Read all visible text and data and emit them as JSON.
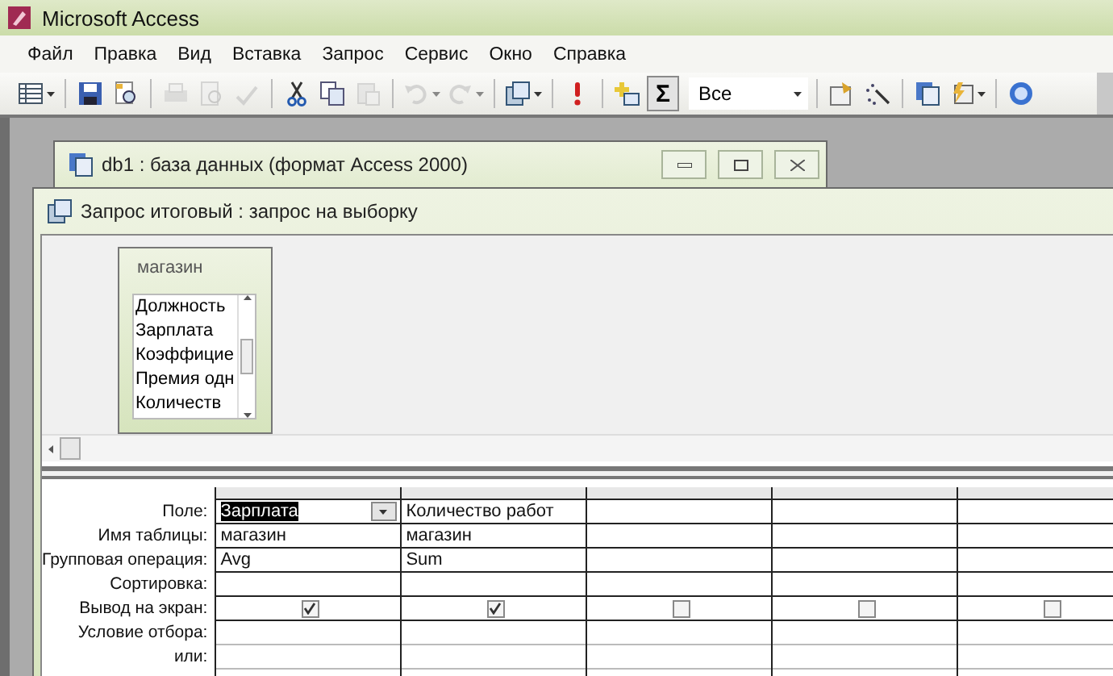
{
  "app_title": "Microsoft Access",
  "menu": [
    "Файл",
    "Правка",
    "Вид",
    "Вставка",
    "Запрос",
    "Сервис",
    "Окно",
    "Справка"
  ],
  "toolbar": [
    {
      "kind": "view",
      "disabled": false
    },
    {
      "kind": "sep"
    },
    {
      "kind": "save",
      "disabled": false
    },
    {
      "kind": "search",
      "disabled": false
    },
    {
      "kind": "sep"
    },
    {
      "kind": "print",
      "disabled": true
    },
    {
      "kind": "preview",
      "disabled": true
    },
    {
      "kind": "spell",
      "disabled": true
    },
    {
      "kind": "sep"
    },
    {
      "kind": "cut",
      "disabled": false
    },
    {
      "kind": "copy",
      "disabled": false
    },
    {
      "kind": "paste",
      "disabled": true
    },
    {
      "kind": "sep"
    },
    {
      "kind": "undo",
      "disabled": true
    },
    {
      "kind": "redo",
      "disabled": true
    },
    {
      "kind": "sep"
    },
    {
      "kind": "querytype",
      "disabled": false
    },
    {
      "kind": "sep"
    },
    {
      "kind": "run",
      "disabled": false
    },
    {
      "kind": "sep"
    },
    {
      "kind": "addtable",
      "disabled": false
    },
    {
      "kind": "totals",
      "label": "Σ",
      "selected": true
    },
    {
      "kind": "combo",
      "value": "Все"
    },
    {
      "kind": "sep"
    },
    {
      "kind": "properties",
      "disabled": false
    },
    {
      "kind": "build",
      "disabled": false
    },
    {
      "kind": "sep"
    },
    {
      "kind": "dbwindow",
      "disabled": false
    },
    {
      "kind": "newobject",
      "disabled": false
    },
    {
      "kind": "sep"
    },
    {
      "kind": "help",
      "disabled": false
    }
  ],
  "db_window": {
    "title": "db1 : база данных (формат Access 2000)"
  },
  "query_window": {
    "title": "Запрос итоговый : запрос на выборку"
  },
  "table_box": {
    "title": "магазин",
    "fields": [
      "Должность",
      "Зарплата",
      "Коэффицие",
      "Премия одн",
      "Количеств"
    ]
  },
  "grid": {
    "row_labels": [
      "Поле:",
      "Имя таблицы:",
      "Групповая операция:",
      "Сортировка:",
      "Вывод на экран:",
      "Условие отбора:",
      "или:"
    ],
    "columns": [
      {
        "field": "Зарплата",
        "field_selected": true,
        "table": "магазин",
        "total": "Avg",
        "show": true
      },
      {
        "field": "Количество работ",
        "field_selected": false,
        "table": "магазин",
        "total": "Sum",
        "show": true
      },
      {
        "show": false
      },
      {
        "show": false
      },
      {
        "show": false
      }
    ]
  }
}
